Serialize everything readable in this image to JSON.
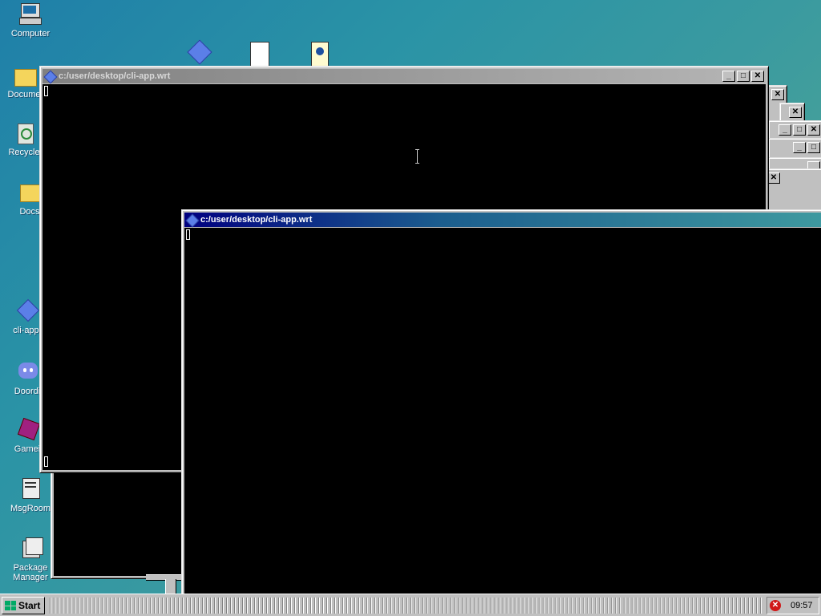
{
  "desktop_icons": [
    {
      "label": "Computer",
      "icon": "computer-icon"
    },
    {
      "label": "Docume",
      "icon": "folder-icon"
    },
    {
      "label": "Recycle",
      "icon": "recycle-bin-icon"
    },
    {
      "label": "Docs",
      "icon": "folder-icon"
    },
    {
      "label": "cli-app.",
      "icon": "diamond-app-icon"
    },
    {
      "label": "Doordi",
      "icon": "chat-icon"
    },
    {
      "label": "Gamei",
      "icon": "game-icon"
    },
    {
      "label": "MsgRoom",
      "icon": "msgroom-icon"
    },
    {
      "label": "Package\nManager",
      "icon": "package-icon"
    }
  ],
  "windows": {
    "back": {
      "title": "c:/user/desktop/cli-app.wrt"
    },
    "front": {
      "title": "c:/user/desktop/cli-app.wrt"
    }
  },
  "taskbar": {
    "start_label": "Start",
    "clock": "09:57",
    "tray_icon": "error-icon"
  },
  "colors": {
    "active_title_start": "#000080",
    "inactive_title": "#808080",
    "terminal_bg": "#000000",
    "desktop": "#2a93a6"
  }
}
